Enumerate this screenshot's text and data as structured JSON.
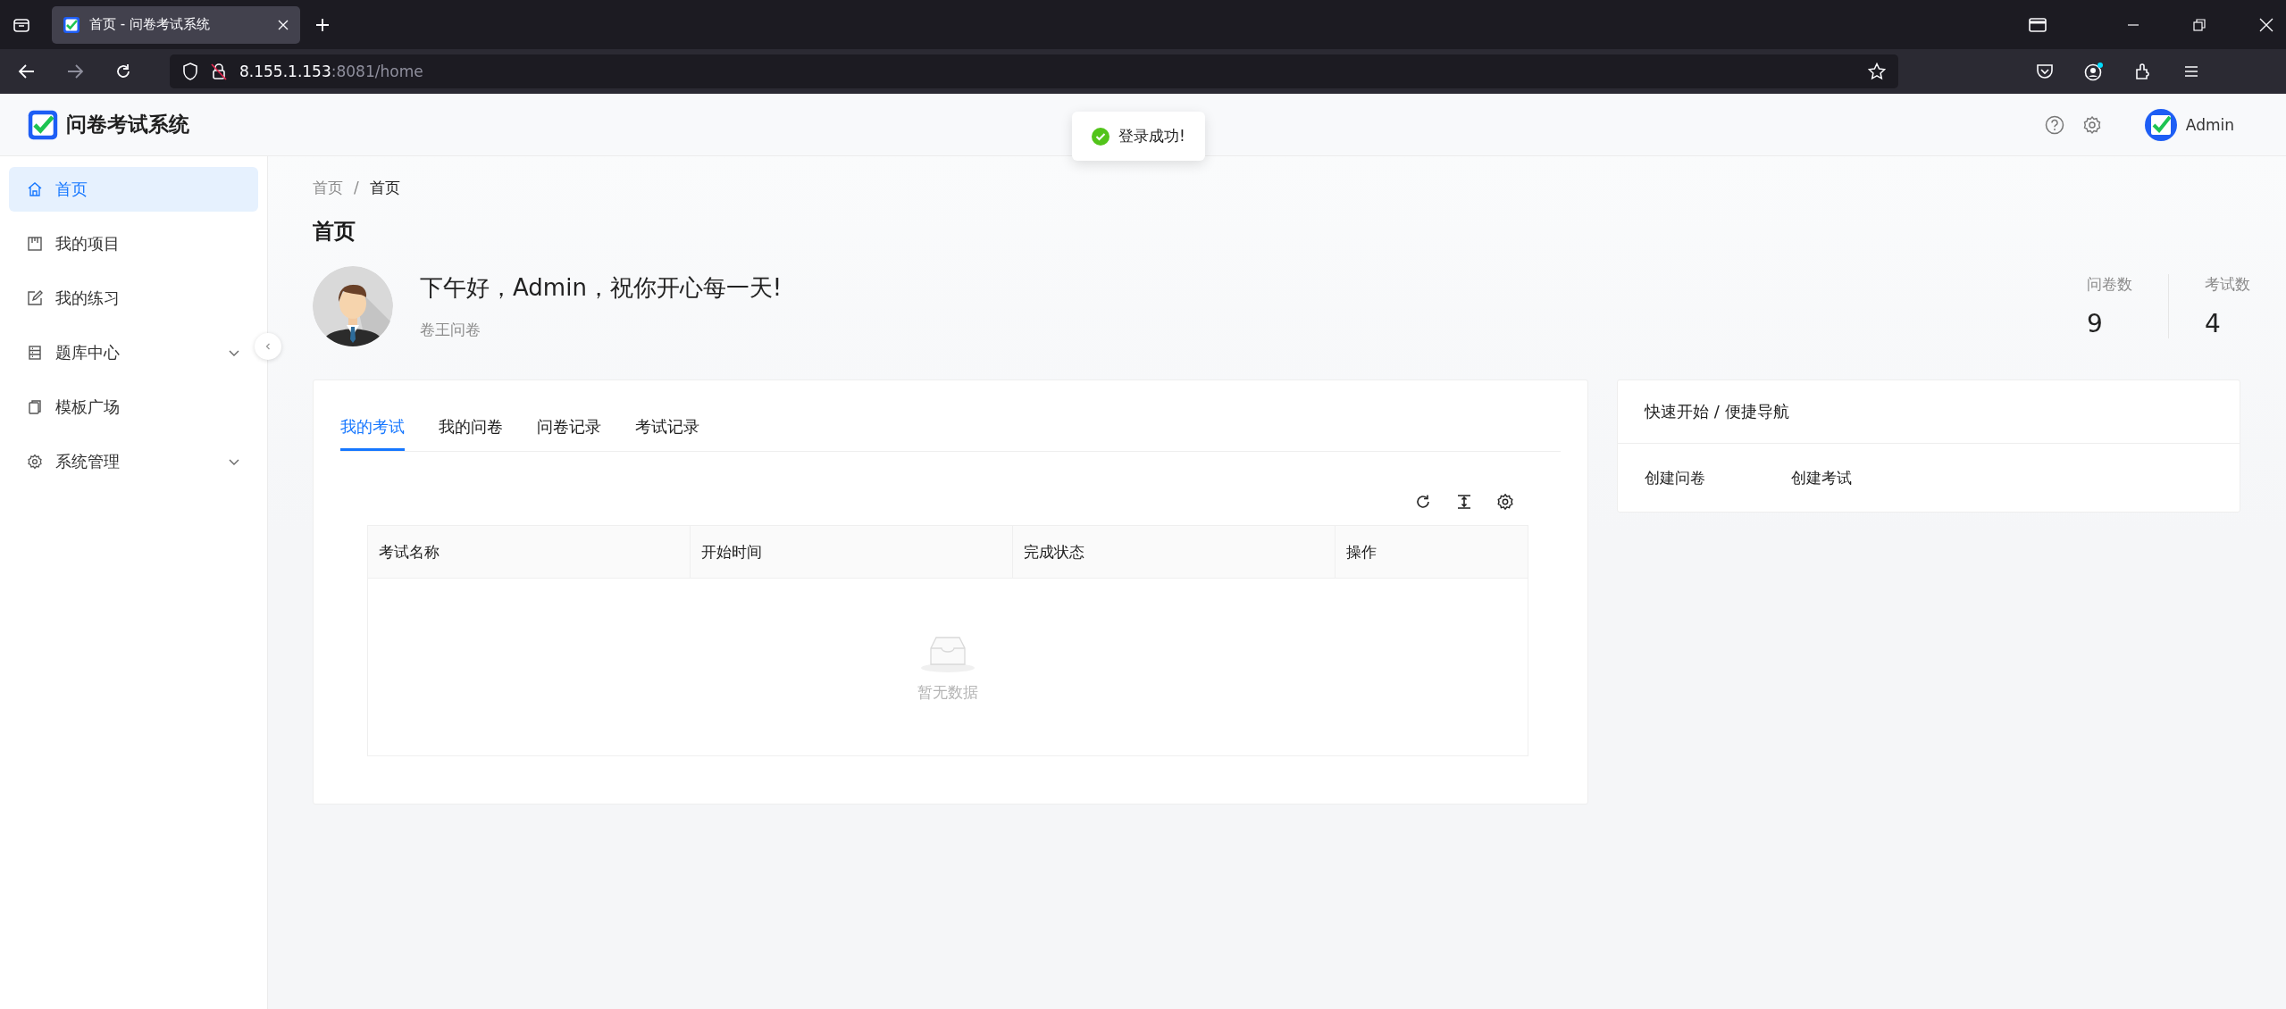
{
  "browser": {
    "tab": {
      "title": "首页 - 问卷考试系统",
      "selected": true
    },
    "url_host": "8.155.1.153",
    "url_path": ":8081/home"
  },
  "header": {
    "title": "问卷考试系统",
    "user": "Admin"
  },
  "toast": {
    "kind": "success",
    "text": "登录成功!"
  },
  "sidebar": {
    "items": [
      {
        "label": "首页",
        "selected": true,
        "expandable": false
      },
      {
        "label": "我的项目",
        "selected": false,
        "expandable": false
      },
      {
        "label": "我的练习",
        "selected": false,
        "expandable": false
      },
      {
        "label": "题库中心",
        "selected": false,
        "expandable": true,
        "expanded": false
      },
      {
        "label": "模板广场",
        "selected": false,
        "expandable": false
      },
      {
        "label": "系统管理",
        "selected": false,
        "expandable": true,
        "expanded": false
      }
    ]
  },
  "breadcrumb": {
    "separator": "/",
    "items": [
      "首页",
      "首页"
    ]
  },
  "page_title": "首页",
  "greeting": "下午好，Admin，祝你开心每一天!",
  "subtitle": "卷王问卷",
  "stats": [
    {
      "label": "问卷数",
      "value": "9"
    },
    {
      "label": "考试数",
      "value": "4"
    }
  ],
  "tabs": [
    {
      "label": "我的考试",
      "selected": true
    },
    {
      "label": "我的问卷",
      "selected": false
    },
    {
      "label": "问卷记录",
      "selected": false
    },
    {
      "label": "考试记录",
      "selected": false
    }
  ],
  "table": {
    "columns": [
      "考试名称",
      "开始时间",
      "完成状态",
      "操作"
    ],
    "empty_text": "暂无数据"
  },
  "quick_nav": {
    "title": "快速开始 / 便捷导航",
    "links": [
      "创建问卷",
      "创建考试"
    ]
  }
}
